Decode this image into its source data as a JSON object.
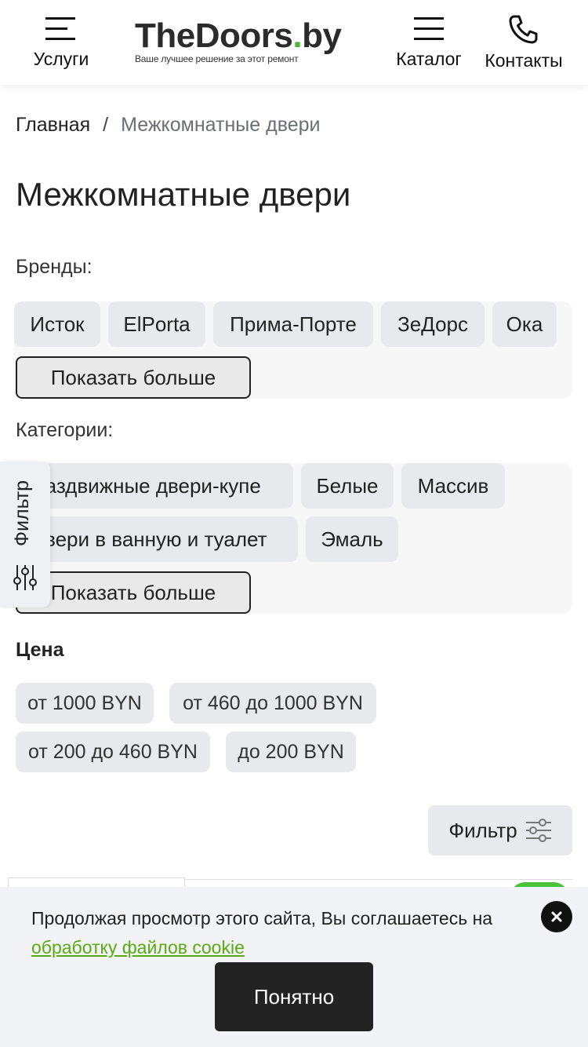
{
  "header": {
    "services_label": "Услуги",
    "logo": {
      "name_main": "TheDoors",
      "name_dot": ".",
      "name_tld": "by",
      "tagline": "Ваше лучшее решение за этот ремонт"
    },
    "catalog_label": "Каталог",
    "contacts_label": "Контакты"
  },
  "breadcrumb": {
    "home": "Главная",
    "separator": "/",
    "current": "Межкомнатные двери"
  },
  "page_title": "Межкомнатные двери",
  "brands": {
    "label": "Бренды:",
    "items": [
      "Исток",
      "ElPorta",
      "Прима-Порте",
      "ЗеДорс",
      "Ока"
    ],
    "show_more": "Показать больше"
  },
  "categories": {
    "label": "Категории:",
    "items": [
      "Раздвижные двери-купе",
      "Белые",
      "Массив",
      "Двери в ванную и туалет",
      "Эмаль"
    ],
    "show_more": "Показать больше"
  },
  "side_filter": {
    "label": "Фильтр",
    "icon": "sliders-icon"
  },
  "price": {
    "label": "Цена",
    "items": [
      "от 1000 BYN",
      "от 460 до 1000 BYN",
      "от 200 до 460 BYN",
      "до 200 BYN"
    ]
  },
  "filter_button": {
    "label": "Фильтр",
    "icon": "filter-sliders-icon"
  },
  "cookie": {
    "text": "Продолжая просмотр этого сайта, Вы соглашаетесь на",
    "link": "обработку файлов cookie",
    "button": "Понятно"
  },
  "colors": {
    "accent_green": "#48b533",
    "link_green": "#5aaa12",
    "chip_bg": "#e8e9ec",
    "dark_button": "#232323"
  }
}
